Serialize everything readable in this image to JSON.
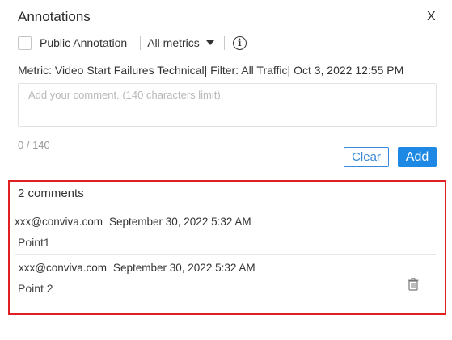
{
  "dialog": {
    "title": "Annotations",
    "close_label": "X"
  },
  "toolbar": {
    "public_label": "Public Annotation",
    "public_checked": false,
    "metrics_selected": "All metrics",
    "info_glyph": "i"
  },
  "meta_line": "Metric: Video Start Failures Technical| Filter: All Traffic| Oct 3, 2022 12:55 PM",
  "input": {
    "placeholder": "Add your comment. (140 characters limit).",
    "value": "",
    "counter": "0 / 140"
  },
  "buttons": {
    "clear": "Clear",
    "add": "Add"
  },
  "comments": {
    "count_label": "2 comments",
    "items": [
      {
        "author": "xxx@conviva.com",
        "date": "September 30, 2022 5:32 AM",
        "text": "Point1"
      },
      {
        "author": "xxx@conviva.com",
        "date": "September 30, 2022 5:32 AM",
        "text": "Point 2",
        "icon": "trash-icon"
      }
    ]
  },
  "colors": {
    "accent": "#1e88e5",
    "highlight_border": "#e02020"
  }
}
